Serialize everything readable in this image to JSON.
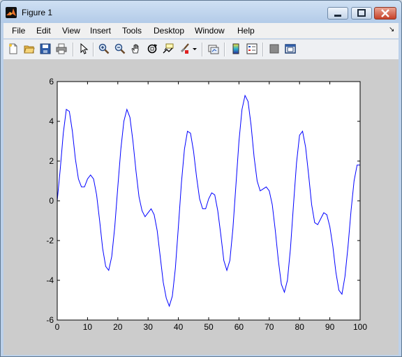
{
  "window": {
    "title": "Figure 1",
    "controls": [
      "minimize",
      "maximize",
      "close"
    ]
  },
  "menubar": {
    "items": [
      "File",
      "Edit",
      "View",
      "Insert",
      "Tools",
      "Desktop",
      "Window",
      "Help"
    ],
    "dock_glyph": "↘"
  },
  "toolbar": {
    "icons": [
      "new-figure-icon",
      "open-file-icon",
      "save-icon",
      "print-icon",
      "edit-plot-arrow-icon",
      "zoom-in-icon",
      "zoom-out-icon",
      "pan-hand-icon",
      "rotate-3d-icon",
      "data-cursor-icon",
      "brush-icon",
      "link-plot-icon",
      "colorbar-icon",
      "legend-icon",
      "hide-plot-tools-icon",
      "show-plot-tools-icon"
    ]
  },
  "colors": {
    "line": "#0000ff",
    "axes_bg": "#ffffff",
    "figure_bg": "#cccccc"
  },
  "chart_data": {
    "type": "line",
    "title": "",
    "xlabel": "",
    "ylabel": "",
    "xlim": [
      0,
      100
    ],
    "ylim": [
      -6,
      6
    ],
    "xticks": [
      0,
      10,
      20,
      30,
      40,
      50,
      60,
      70,
      80,
      90,
      100
    ],
    "yticks": [
      -6,
      -4,
      -2,
      0,
      2,
      4,
      6
    ],
    "grid": false,
    "series": [
      {
        "color": "#0000ff",
        "x": [
          0,
          1,
          2,
          3,
          4,
          5,
          6,
          7,
          8,
          9,
          10,
          11,
          12,
          13,
          14,
          15,
          16,
          17,
          18,
          19,
          20,
          21,
          22,
          23,
          24,
          25,
          26,
          27,
          28,
          29,
          30,
          31,
          32,
          33,
          34,
          35,
          36,
          37,
          38,
          39,
          40,
          41,
          42,
          43,
          44,
          45,
          46,
          47,
          48,
          49,
          50,
          51,
          52,
          53,
          54,
          55,
          56,
          57,
          58,
          59,
          60,
          61,
          62,
          63,
          64,
          65,
          66,
          67,
          68,
          69,
          70,
          71,
          72,
          73,
          74,
          75,
          76,
          77,
          78,
          79,
          80,
          81,
          82,
          83,
          84,
          85,
          86,
          87,
          88,
          89,
          90,
          91,
          92,
          93,
          94,
          95,
          96,
          97,
          98,
          99,
          100
        ],
        "y": [
          0.0,
          1.6,
          3.4,
          4.6,
          4.5,
          3.5,
          2.1,
          1.1,
          0.7,
          0.7,
          1.1,
          1.3,
          1.1,
          0.3,
          -1.0,
          -2.4,
          -3.3,
          -3.5,
          -2.8,
          -1.3,
          0.7,
          2.6,
          4.0,
          4.6,
          4.2,
          3.0,
          1.5,
          0.2,
          -0.5,
          -0.8,
          -0.6,
          -0.4,
          -0.7,
          -1.5,
          -2.8,
          -4.1,
          -4.9,
          -5.3,
          -4.8,
          -3.4,
          -1.3,
          0.9,
          2.6,
          3.5,
          3.4,
          2.5,
          1.2,
          0.1,
          -0.4,
          -0.4,
          0.1,
          0.4,
          0.3,
          -0.5,
          -1.7,
          -3.0,
          -3.5,
          -3.0,
          -1.4,
          0.8,
          3.0,
          4.6,
          5.3,
          5.0,
          3.8,
          2.2,
          1.0,
          0.5,
          0.6,
          0.7,
          0.5,
          -0.2,
          -1.5,
          -3.0,
          -4.2,
          -4.6,
          -4.0,
          -2.4,
          -0.2,
          1.9,
          3.3,
          3.5,
          2.7,
          1.3,
          -0.2,
          -1.1,
          -1.2,
          -0.9,
          -0.6,
          -0.7,
          -1.3,
          -2.3,
          -3.6,
          -4.5,
          -4.7,
          -3.8,
          -2.3,
          -0.5,
          1.0,
          1.8,
          1.8
        ]
      }
    ]
  }
}
